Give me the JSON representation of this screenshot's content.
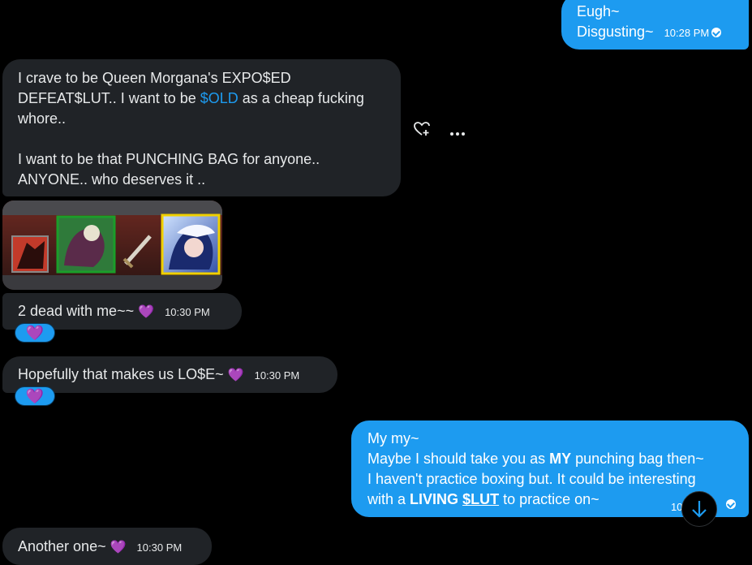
{
  "messages": {
    "m1": {
      "line1": "Eugh~",
      "line2": "Disgusting~",
      "time": "10:28 PM"
    },
    "m2": {
      "l1": "I crave to be Queen Morgana's EXPO$ED",
      "l2a": "DEFEAT$LUT.. I want to be ",
      "l2b": "$OLD",
      "l2c": " as a cheap fucking",
      "l3": "whore..",
      "l4": "I want to be that PUNCHING BAG for anyone..",
      "l5": "ANYONE.. who deserves it .."
    },
    "m3": {
      "text": "2 dead with me~~",
      "heart": "💜",
      "time": "10:30 PM",
      "reaction": "💜"
    },
    "m4": {
      "text": "Hopefully that makes us LO$E~",
      "heart": "💜",
      "time": "10:30 PM",
      "reaction": "💜"
    },
    "m5": {
      "l1": "My my~",
      "l2a": "Maybe I should take you as ",
      "l2b": "MY",
      "l2c": " punching bag then~",
      "l3": "I haven't practice boxing but. It could be interesting",
      "l4a": "with a ",
      "l4b": "LIVING",
      "l4c": "$LUT",
      "l4d": " to practice on~",
      "time": "10:"
    },
    "m6": {
      "text": "Another one~",
      "heart": "💜",
      "time": "10:30 PM"
    }
  },
  "icons": {
    "react": "heart-plus-icon",
    "more": "more-icon",
    "scroll": "arrow-down-icon"
  },
  "colors": {
    "accent": "#1d9bf0",
    "incoming": "#202327",
    "background": "#000000"
  }
}
